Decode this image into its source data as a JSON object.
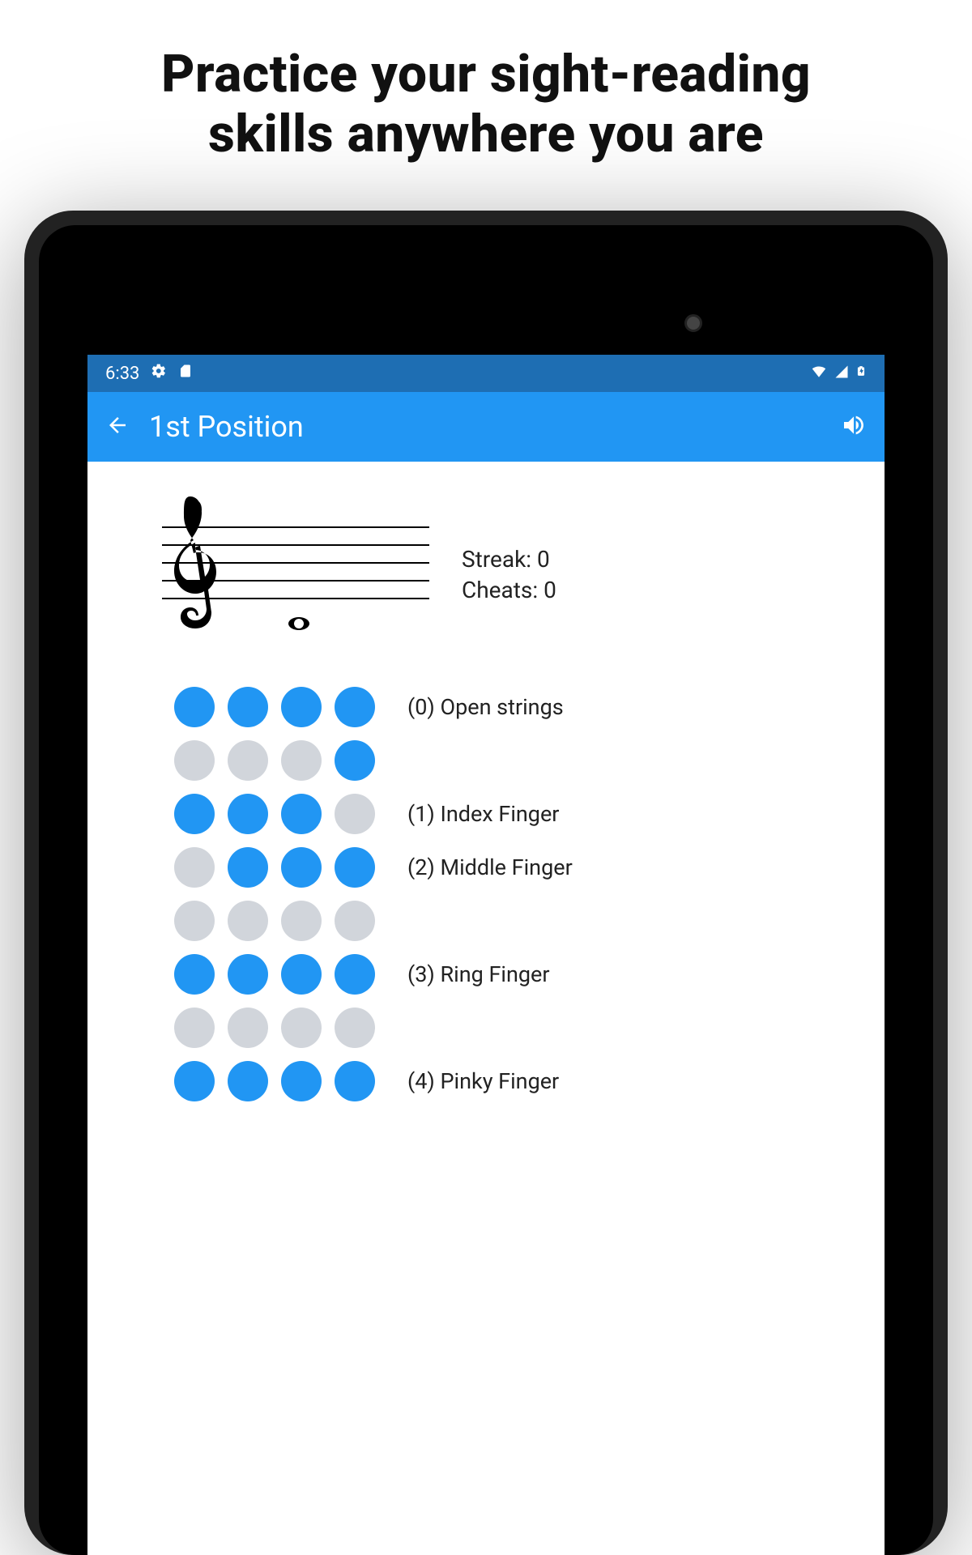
{
  "promo": {
    "line1": "Practice your sight-reading",
    "line2": "skills anywhere you are"
  },
  "status_bar": {
    "time": "6:33",
    "icons": {
      "gear": "gear-icon",
      "sd": "sd-card-icon",
      "wifi": "wifi-icon",
      "signal": "signal-icon",
      "battery": "battery-charging-icon"
    }
  },
  "app_bar": {
    "title": "1st Position"
  },
  "stats": {
    "streak_label": "Streak:",
    "streak_value": "0",
    "cheats_label": "Cheats:",
    "cheats_value": "0"
  },
  "fret_rows": [
    {
      "dots": [
        true,
        true,
        true,
        true
      ],
      "label": "(0) Open strings"
    },
    {
      "dots": [
        false,
        false,
        false,
        true
      ],
      "label": ""
    },
    {
      "dots": [
        true,
        true,
        true,
        false
      ],
      "label": "(1) Index Finger"
    },
    {
      "dots": [
        false,
        true,
        true,
        true
      ],
      "label": "(2) Middle Finger"
    },
    {
      "dots": [
        false,
        false,
        false,
        false
      ],
      "label": ""
    },
    {
      "dots": [
        true,
        true,
        true,
        true
      ],
      "label": "(3) Ring Finger"
    },
    {
      "dots": [
        false,
        false,
        false,
        false
      ],
      "label": ""
    },
    {
      "dots": [
        true,
        true,
        true,
        true
      ],
      "label": "(4) Pinky Finger"
    }
  ],
  "colors": {
    "accent": "#2196f3",
    "status_bg": "#1e6eb3",
    "dot_inactive": "#d1d5db"
  }
}
